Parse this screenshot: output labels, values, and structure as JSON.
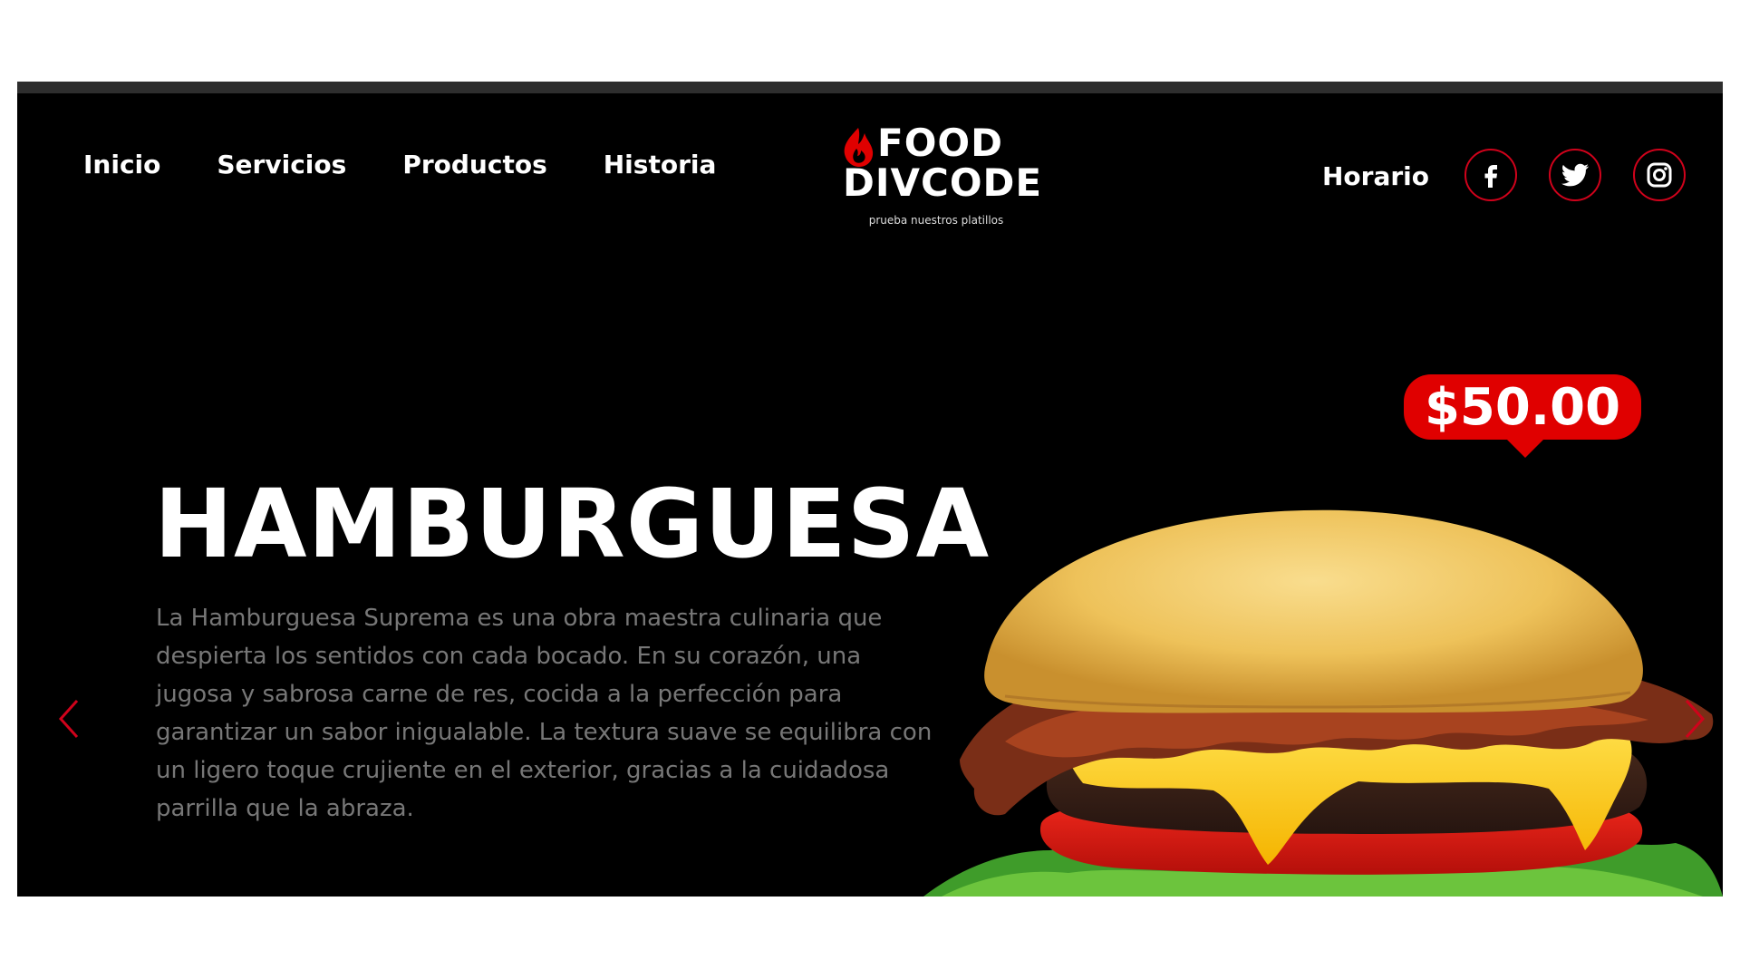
{
  "nav": {
    "items": [
      {
        "label": "Inicio"
      },
      {
        "label": "Servicios"
      },
      {
        "label": "Productos"
      },
      {
        "label": "Historia"
      }
    ]
  },
  "logo": {
    "line1": "FOOD",
    "line2": "DIVCODE",
    "tagline": "prueba nuestros platillos"
  },
  "header_right": {
    "schedule_label": "Horario",
    "social_icons": [
      "facebook-icon",
      "twitter-icon",
      "instagram-icon"
    ]
  },
  "product": {
    "price": "$50.00",
    "title": "HAMBURGUESA",
    "description": "La Hamburguesa Suprema es una obra maestra culinaria que despierta los sentidos con cada bocado. En su corazón, una jugosa y sabrosa carne de res, cocida a la perfección para garantizar un sabor inigualable. La textura suave se equilibra con un ligero toque crujiente en el exterior, gracias a la cuidadosa parrilla que la abraza."
  },
  "carousel": {
    "prev_icon": "chevron-left-icon",
    "next_icon": "chevron-right-icon"
  },
  "colors": {
    "background": "#000000",
    "accent": "#e00000",
    "text": "#ffffff",
    "muted_text": "#777777"
  }
}
